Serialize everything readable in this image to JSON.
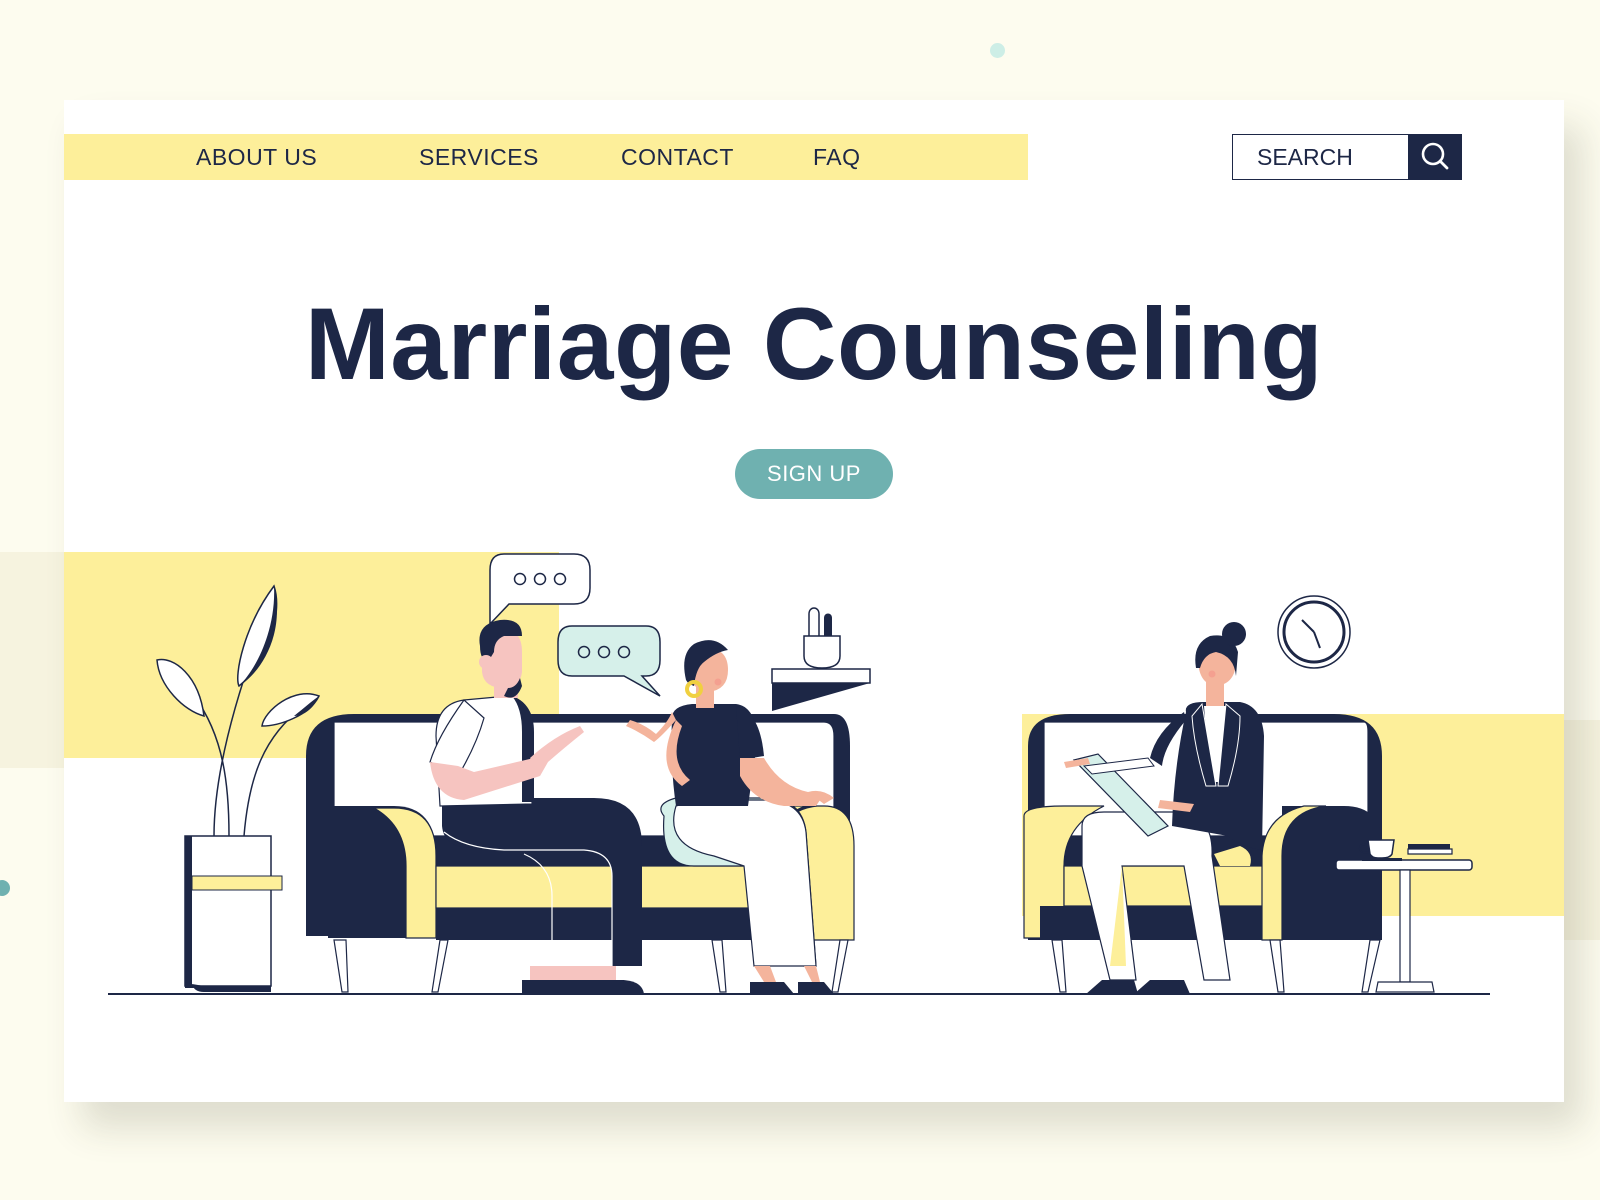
{
  "theme": {
    "background": "#fdfcef",
    "card": "#ffffff",
    "navy": "#1d2746",
    "yellow": "#fdef9a",
    "teal": "#6fb1b0",
    "mint": "#d6f0ea",
    "skin": "#f4b49c",
    "pink_shirt": "#f6c4c0"
  },
  "nav": {
    "items": [
      {
        "label": "ABOUT US"
      },
      {
        "label": "SERVICES"
      },
      {
        "label": "CONTACT"
      },
      {
        "label": "FAQ"
      }
    ]
  },
  "search": {
    "placeholder": "SEARCH",
    "icon": "search-icon"
  },
  "hero": {
    "title": "Marriage Counseling",
    "cta_label": "SIGN UP"
  },
  "illustration": {
    "scene": "therapy-session",
    "icons": [
      "plant-icon",
      "speech-bubble-icon",
      "sofa-icon",
      "clock-icon",
      "coffee-cup-icon",
      "clipboard-icon"
    ]
  }
}
